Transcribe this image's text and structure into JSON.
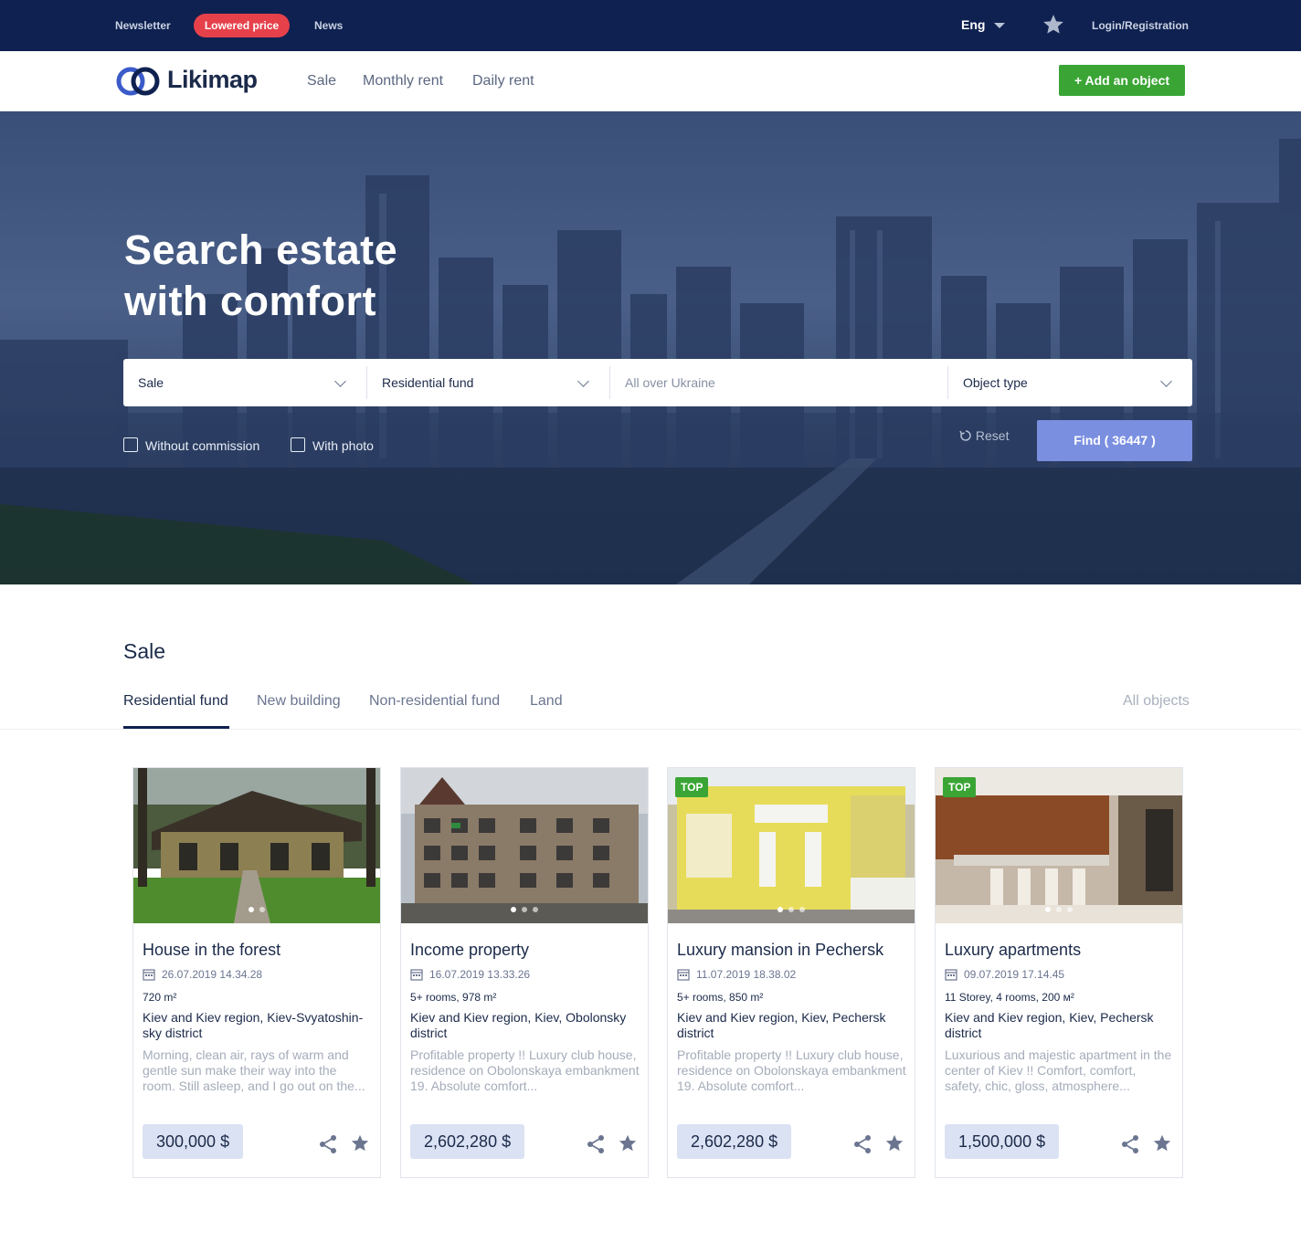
{
  "topbar": {
    "newsletter": "Newsletter",
    "lowered_price": "Lowered price",
    "news": "News",
    "language": "Eng",
    "login": "Login/Registration"
  },
  "nav": {
    "logo": "Likimap",
    "links": [
      "Sale",
      "Monthly rent",
      "Daily rent"
    ],
    "add_object": "+ Add an object"
  },
  "hero": {
    "title_line1": "Search estate",
    "title_line2": "with comfort",
    "search": {
      "deal": "Sale",
      "category": "Residential fund",
      "location_placeholder": "All over Ukraine",
      "object_type": "Object type"
    },
    "without_commission": "Without commission",
    "with_photo": "With photo",
    "reset": "Reset",
    "find": "Find ( 36447 )"
  },
  "sale": {
    "title": "Sale",
    "tabs": [
      "Residential fund",
      "New building",
      "Non-residential fund",
      "Land"
    ],
    "all_objects": "All objects",
    "top_label": "TOP",
    "cards": [
      {
        "title": "House in the forest",
        "date": "26.07.2019 14.34.28",
        "spec": "720 m²",
        "location": "Kiev and Kiev region, Kiev-Svyatoshin-sky district",
        "description": "Morning, clean air, rays of warm and gentle sun make their way into the room. Still asleep, and I go out on the...",
        "price": "300,000 $",
        "top": false
      },
      {
        "title": "Income property",
        "date": "16.07.2019 13.33.26",
        "spec": "5+ rooms, 978 m²",
        "location": "Kiev and Kiev region, Kiev, Obolonsky district",
        "description": "Profitable property !! Luxury club house, residence on Obolonskaya embankment 19. Absolute comfort...",
        "price": "2,602,280 $",
        "top": false
      },
      {
        "title": "Luxury mansion in Pechersk",
        "date": "11.07.2019 18.38.02",
        "spec": "5+ rooms, 850 m²",
        "location": "Kiev and Kiev region, Kiev, Pechersk district",
        "description": "Profitable property !! Luxury club house, residence on Obolonskaya embankment 19. Absolute comfort...",
        "price": "2,602,280 $",
        "top": true
      },
      {
        "title": "Luxury apartments",
        "date": "09.07.2019 17.14.45",
        "spec": "11 Storey, 4 rooms, 200 м²",
        "location": "Kiev and Kiev region, Kiev, Pechersk district",
        "description": "Luxurious and majestic apartment in the center of Kiev !! Comfort, comfort, safety, chic, gloss, atmosphere...",
        "price": "1,500,000 $",
        "top": true
      }
    ]
  },
  "colors": {
    "topbar_bg": "#0f2150",
    "accent_red": "#e6414b",
    "accent_green": "#3aa535",
    "find_button": "#7a8fe0",
    "price_bg": "#dbe2f3"
  }
}
